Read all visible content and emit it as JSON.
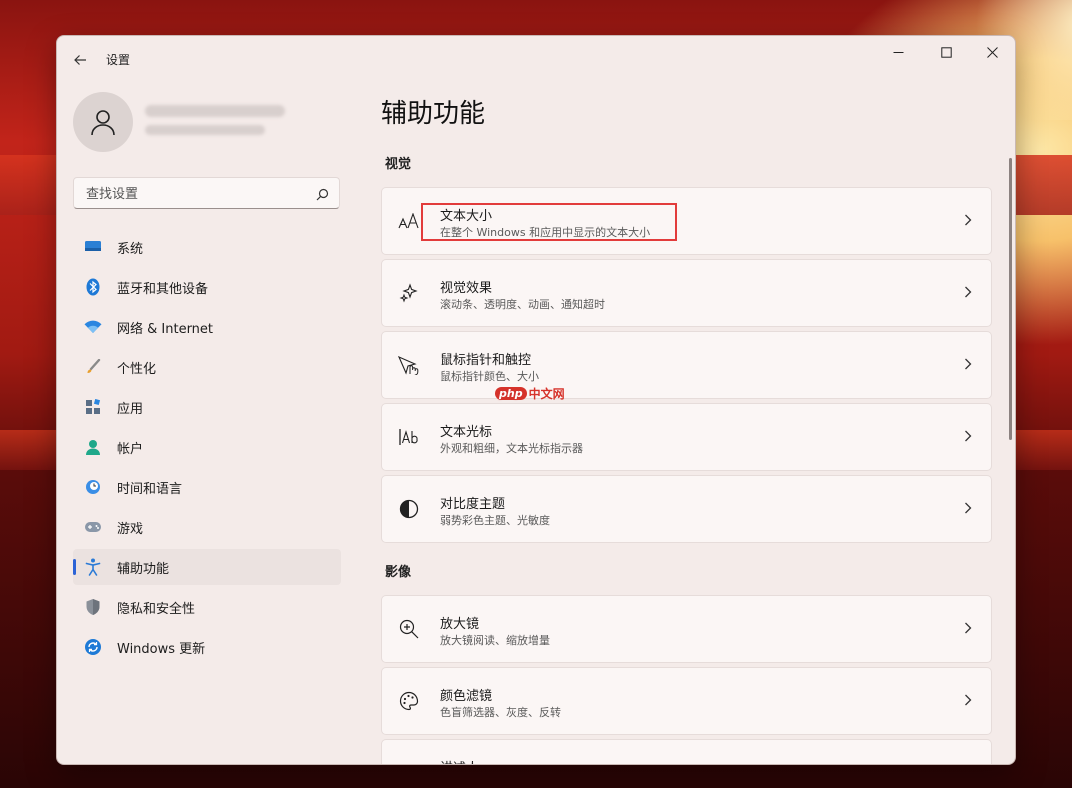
{
  "window": {
    "title": "设置"
  },
  "search": {
    "placeholder": "查找设置"
  },
  "nav": {
    "items": [
      {
        "label": "系统",
        "icon": "monitor-icon"
      },
      {
        "label": "蓝牙和其他设备",
        "icon": "bluetooth-icon"
      },
      {
        "label": "网络 & Internet",
        "icon": "wifi-icon"
      },
      {
        "label": "个性化",
        "icon": "brush-icon"
      },
      {
        "label": "应用",
        "icon": "apps-icon"
      },
      {
        "label": "帐户",
        "icon": "account-icon"
      },
      {
        "label": "时间和语言",
        "icon": "clock-globe-icon"
      },
      {
        "label": "游戏",
        "icon": "gamepad-icon"
      },
      {
        "label": "辅助功能",
        "icon": "accessibility-icon",
        "active": true
      },
      {
        "label": "隐私和安全性",
        "icon": "shield-icon"
      },
      {
        "label": "Windows 更新",
        "icon": "update-icon"
      }
    ]
  },
  "main": {
    "title": "辅助功能",
    "sections": [
      {
        "title": "视觉",
        "cards": [
          {
            "title": "文本大小",
            "subtitle": "在整个 Windows 和应用中显示的文本大小",
            "icon": "text-size-icon",
            "highlighted": true
          },
          {
            "title": "视觉效果",
            "subtitle": "滚动条、透明度、动画、通知超时",
            "icon": "sparkle-icon"
          },
          {
            "title": "鼠标指针和触控",
            "subtitle": "鼠标指针颜色、大小",
            "icon": "pointer-icon"
          },
          {
            "title": "文本光标",
            "subtitle": "外观和粗细，文本光标指示器",
            "icon": "text-cursor-icon"
          },
          {
            "title": "对比度主题",
            "subtitle": "弱势彩色主题、光敏度",
            "icon": "contrast-icon"
          }
        ]
      },
      {
        "title": "影像",
        "cards": [
          {
            "title": "放大镜",
            "subtitle": "放大镜阅读、缩放增量",
            "icon": "magnifier-icon"
          },
          {
            "title": "颜色滤镜",
            "subtitle": "色盲筛选器、灰度、反转",
            "icon": "palette-icon"
          },
          {
            "title": "讲述人",
            "subtitle": "",
            "icon": "narrator-icon"
          }
        ]
      }
    ]
  },
  "watermark": {
    "badge": "php",
    "text": "中文网"
  },
  "colors": {
    "accent": "#2c63d6",
    "highlight_box": "#e23b3b",
    "window_bg": "#f4ebe9"
  }
}
